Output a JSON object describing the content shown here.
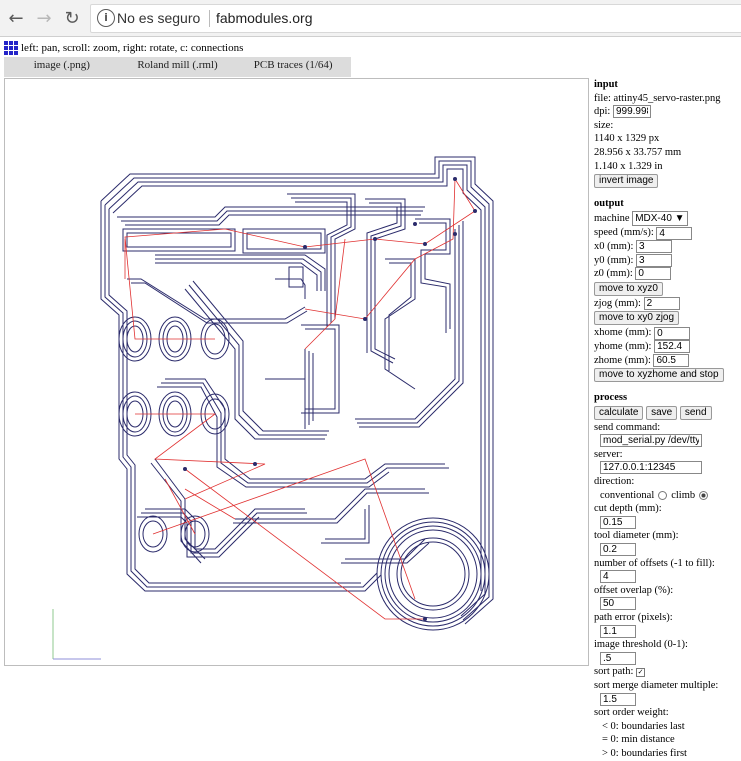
{
  "browser": {
    "security_label": "No es seguro",
    "url": "fabmodules.org"
  },
  "app": {
    "hint": "left: pan, scroll: zoom, right: rotate, c: connections",
    "tabs": [
      "image (.png)",
      "Roland mill (.rml)",
      "PCB traces (1/64)"
    ]
  },
  "input": {
    "heading": "input",
    "file_label": "file:",
    "file_name": "attiny45_servo-raster.png",
    "dpi_label": "dpi:",
    "dpi": "999.998",
    "size_label": "size:",
    "size_px": "1140 x 1329 px",
    "size_mm": "28.956 x 33.757 mm",
    "size_in": "1.140 x 1.329 in",
    "invert_button": "invert image"
  },
  "output": {
    "heading": "output",
    "machine_label": "machine",
    "machine": "MDX-40 ▼",
    "speed_label": "speed (mm/s):",
    "speed": "4",
    "x0_label": "x0 (mm):",
    "x0": "3",
    "y0_label": "y0 (mm):",
    "y0": "3",
    "z0_label": "z0 (mm):",
    "z0": "0",
    "move_xyz0": "move to xyz0",
    "zjog_label": "zjog (mm):",
    "zjog": "2",
    "move_xy0_zjog": "move to xy0 zjog",
    "xhome_label": "xhome (mm):",
    "xhome": "0",
    "yhome_label": "yhome (mm):",
    "yhome": "152.4",
    "zhome_label": "zhome (mm):",
    "zhome": "60.5",
    "move_home": "move to xyzhome and stop"
  },
  "process": {
    "heading": "process",
    "calculate": "calculate",
    "save": "save",
    "send": "send",
    "send_command_label": "send command:",
    "send_command": "mod_serial.py /dev/ttyUS",
    "server_label": "server:",
    "server": "127.0.0.1:12345",
    "direction_label": "direction:",
    "conventional": "conventional",
    "climb": "climb",
    "cut_depth_label": "cut depth (mm):",
    "cut_depth": "0.15",
    "tool_diameter_label": "tool diameter (mm):",
    "tool_diameter": "0.2",
    "offsets_label": "number of offsets (-1 to fill):",
    "offsets": "4",
    "overlap_label": "offset overlap (%):",
    "overlap": "50",
    "path_error_label": "path error (pixels):",
    "path_error": "1.1",
    "threshold_label": "image threshold (0-1):",
    "threshold": ".5",
    "sort_path_label": "sort path:",
    "merge_label": "sort merge diameter multiple:",
    "merge": "1.5",
    "order_label": "sort order weight:",
    "order_lines": [
      "< 0: boundaries last",
      "= 0: min distance",
      "> 0: boundaries first"
    ]
  }
}
